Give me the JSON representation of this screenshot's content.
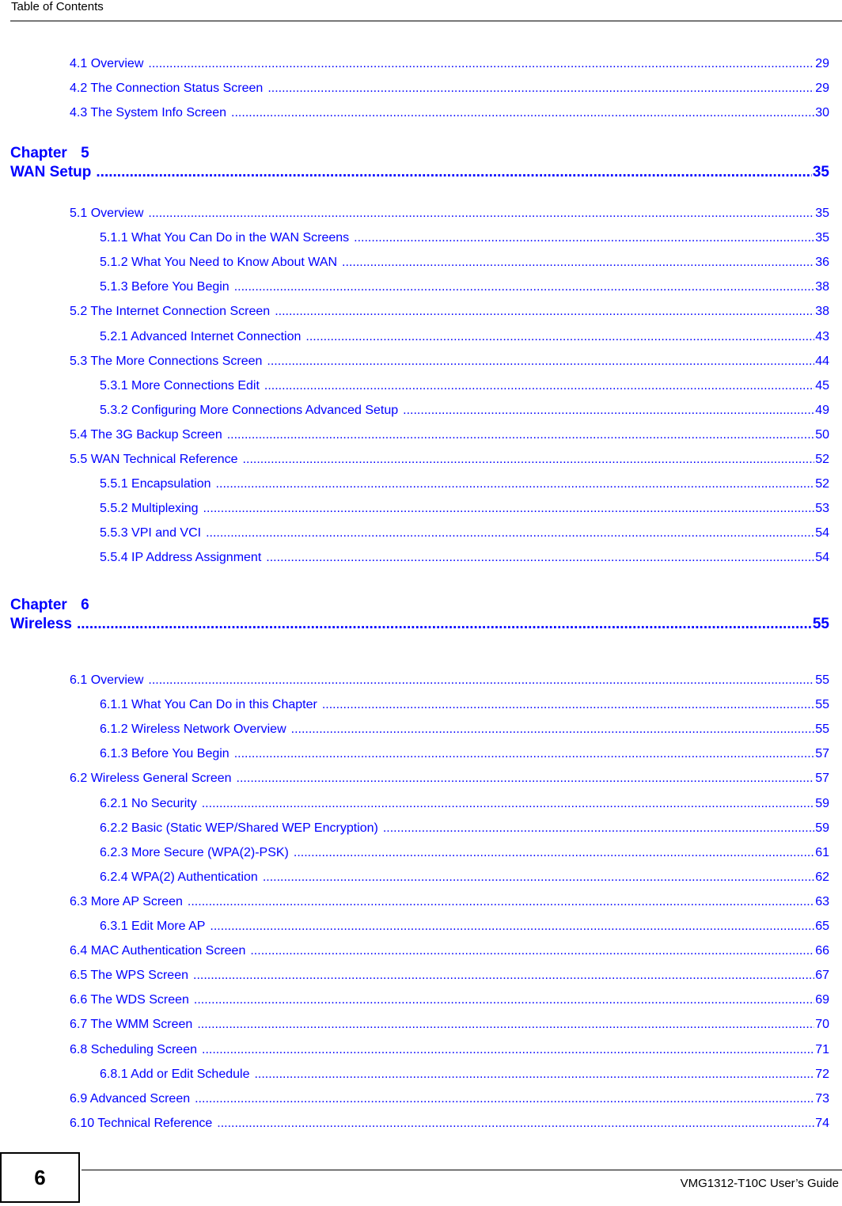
{
  "header": {
    "title": "Table of Contents"
  },
  "colors": {
    "link": "#0000ff",
    "text": "#000000"
  },
  "toc": {
    "pre": [
      {
        "label": "4.1 Overview",
        "page": "29",
        "level": 1
      },
      {
        "label": "4.2 The Connection Status Screen",
        "page": "29",
        "level": 1
      },
      {
        "label": "4.3 The System Info Screen",
        "page": "30",
        "level": 1
      }
    ],
    "chapter5": {
      "chapter_label": "Chapter   5",
      "title": "WAN Setup",
      "page": "35",
      "entries": [
        {
          "label": "5.1 Overview",
          "page": "35",
          "level": 1
        },
        {
          "label": "5.1.1 What You Can Do in the WAN Screens",
          "page": "35",
          "level": 2
        },
        {
          "label": "5.1.2 What You Need to Know About WAN",
          "page": "36",
          "level": 2
        },
        {
          "label": "5.1.3 Before You Begin",
          "page": "38",
          "level": 2
        },
        {
          "label": "5.2 The Internet Connection Screen",
          "page": "38",
          "level": 1
        },
        {
          "label": "5.2.1 Advanced Internet Connection",
          "page": "43",
          "level": 2
        },
        {
          "label": "5.3 The More Connections Screen",
          "page": "44",
          "level": 1
        },
        {
          "label": "5.3.1 More Connections Edit",
          "page": "45",
          "level": 2
        },
        {
          "label": "5.3.2 Configuring More Connections Advanced Setup",
          "page": "49",
          "level": 2
        },
        {
          "label": "5.4 The 3G Backup Screen",
          "page": "50",
          "level": 1
        },
        {
          "label": "5.5 WAN Technical Reference",
          "page": "52",
          "level": 1
        },
        {
          "label": "5.5.1 Encapsulation",
          "page": "52",
          "level": 2
        },
        {
          "label": "5.5.2 Multiplexing",
          "page": "53",
          "level": 2
        },
        {
          "label": "5.5.3 VPI and VCI",
          "page": "54",
          "level": 2
        },
        {
          "label": "5.5.4 IP Address Assignment",
          "page": "54",
          "level": 2
        }
      ]
    },
    "chapter6": {
      "chapter_label": "Chapter   6",
      "title": "Wireless",
      "page": "55",
      "entries": [
        {
          "label": "6.1 Overview",
          "page": "55",
          "level": 1
        },
        {
          "label": "6.1.1 What You Can Do in this Chapter",
          "page": "55",
          "level": 2
        },
        {
          "label": "6.1.2 Wireless Network Overview",
          "page": "55",
          "level": 2
        },
        {
          "label": "6.1.3 Before You Begin",
          "page": "57",
          "level": 2
        },
        {
          "label": "6.2 Wireless General Screen",
          "page": "57",
          "level": 1
        },
        {
          "label": "6.2.1 No Security",
          "page": "59",
          "level": 2
        },
        {
          "label": "6.2.2 Basic (Static WEP/Shared WEP Encryption)",
          "page": "59",
          "level": 2
        },
        {
          "label": "6.2.3 More Secure (WPA(2)-PSK)",
          "page": "61",
          "level": 2
        },
        {
          "label": "6.2.4 WPA(2) Authentication",
          "page": "62",
          "level": 2
        },
        {
          "label": "6.3 More AP Screen",
          "page": "63",
          "level": 1
        },
        {
          "label": "6.3.1 Edit More AP",
          "page": "65",
          "level": 2
        },
        {
          "label": "6.4 MAC Authentication Screen",
          "page": "66",
          "level": 1
        },
        {
          "label": "6.5 The WPS Screen",
          "page": "67",
          "level": 1
        },
        {
          "label": "6.6 The WDS Screen",
          "page": "69",
          "level": 1
        },
        {
          "label": "6.7 The WMM Screen",
          "page": "70",
          "level": 1
        },
        {
          "label": "6.8 Scheduling Screen",
          "page": "71",
          "level": 1
        },
        {
          "label": "6.8.1 Add or Edit Schedule",
          "page": "72",
          "level": 2
        },
        {
          "label": "6.9 Advanced Screen",
          "page": "73",
          "level": 1
        },
        {
          "label": "6.10 Technical Reference",
          "page": "74",
          "level": 1
        }
      ]
    }
  },
  "footer": {
    "page_number": "6",
    "guide_title": "VMG1312-T10C User’s Guide"
  }
}
